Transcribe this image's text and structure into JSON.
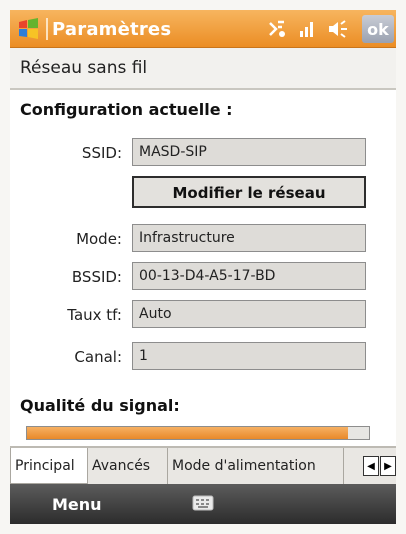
{
  "titlebar": {
    "title": "Paramètres",
    "ok_label": "ok",
    "icons": [
      "start-windows-icon",
      "connectivity-icon",
      "signal-icon",
      "volume-icon"
    ]
  },
  "page_header": {
    "title": "Réseau sans fil"
  },
  "section_current": {
    "title": "Configuration actuelle :"
  },
  "fields": {
    "ssid": {
      "label": "SSID:",
      "value": "MASD-SIP"
    },
    "mode": {
      "label": "Mode:",
      "value": "Infrastructure"
    },
    "bssid": {
      "label": "BSSID:",
      "value": "00-13-D4-A5-17-BD"
    },
    "taux": {
      "label": "Taux tf:",
      "value": "Auto"
    },
    "canal": {
      "label": "Canal:",
      "value": "1"
    }
  },
  "modify_button": {
    "label": "Modifier le réseau"
  },
  "signal": {
    "label": "Qualité du signal:",
    "quality_percent": 94
  },
  "tabs": [
    {
      "label": "Principal",
      "active": true
    },
    {
      "label": "Avancés",
      "active": false
    },
    {
      "label": "Mode d'alimentation",
      "active": false
    }
  ],
  "menubar": {
    "menu_label": "Menu"
  },
  "colors": {
    "titlebar_orange": "#eb8d24",
    "signal_fill": "#e8892a",
    "field_bg": "#dedcd8"
  }
}
